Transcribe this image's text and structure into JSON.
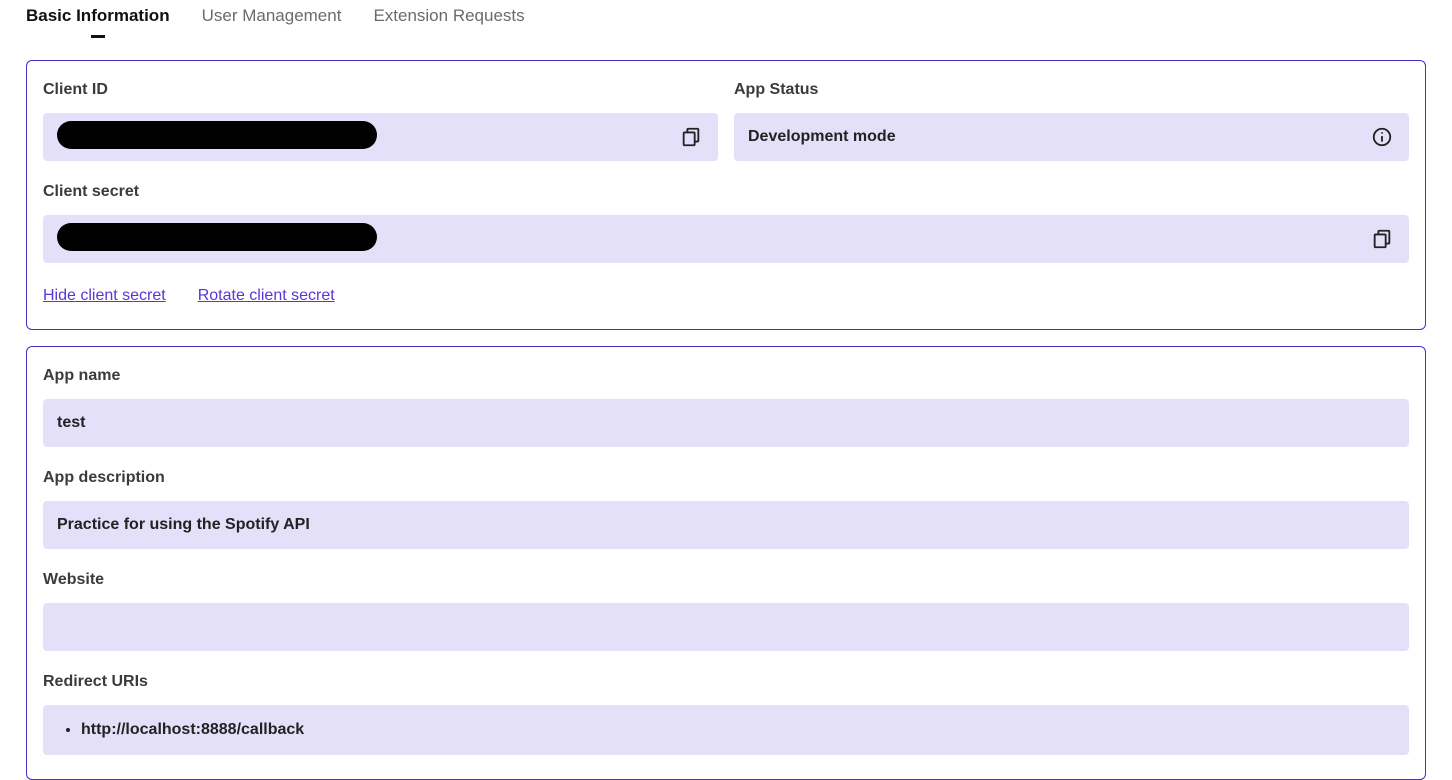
{
  "tabs": [
    {
      "label": "Basic Information",
      "active": true
    },
    {
      "label": "User Management",
      "active": false
    },
    {
      "label": "Extension Requests",
      "active": false
    }
  ],
  "credentials": {
    "client_id_label": "Client ID",
    "client_id_value": "",
    "app_status_label": "App Status",
    "app_status_value": "Development mode",
    "client_secret_label": "Client secret",
    "client_secret_value": "",
    "hide_secret_link": "Hide client secret",
    "rotate_secret_link": "Rotate client secret"
  },
  "app": {
    "name_label": "App name",
    "name_value": "test",
    "description_label": "App description",
    "description_value": "Practice for using the Spotify API",
    "website_label": "Website",
    "website_value": "",
    "redirect_label": "Redirect URIs",
    "redirect_uris": [
      "http://localhost:8888/callback"
    ]
  }
}
